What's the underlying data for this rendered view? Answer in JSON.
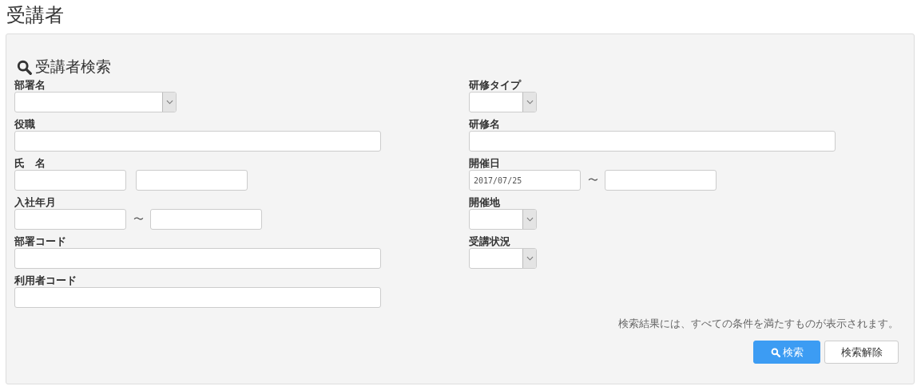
{
  "page_title": "受講者",
  "search_panel": {
    "title": "受講者検索",
    "left_fields": [
      {
        "label": "部署名",
        "kind": "select"
      },
      {
        "label": "役職",
        "kind": "text"
      },
      {
        "label": "氏　名",
        "kind": "pair"
      },
      {
        "label": "入社年月",
        "kind": "range",
        "separator": "〜"
      },
      {
        "label": "部署コード",
        "kind": "text"
      },
      {
        "label": "利用者コード",
        "kind": "text"
      }
    ],
    "right_fields": [
      {
        "label": "研修タイプ",
        "kind": "select"
      },
      {
        "label": "研修名",
        "kind": "text"
      },
      {
        "label": "開催日",
        "kind": "range",
        "separator": "〜",
        "value": "2017/07/25"
      },
      {
        "label": "開催地",
        "kind": "select"
      },
      {
        "label": "受講状況",
        "kind": "select"
      }
    ],
    "note": "検索結果には、すべての条件を満たすものが表示されます。",
    "buttons": [
      {
        "label": "検索",
        "kind": "primary"
      },
      {
        "label": "検索解除",
        "kind": "default"
      }
    ]
  }
}
